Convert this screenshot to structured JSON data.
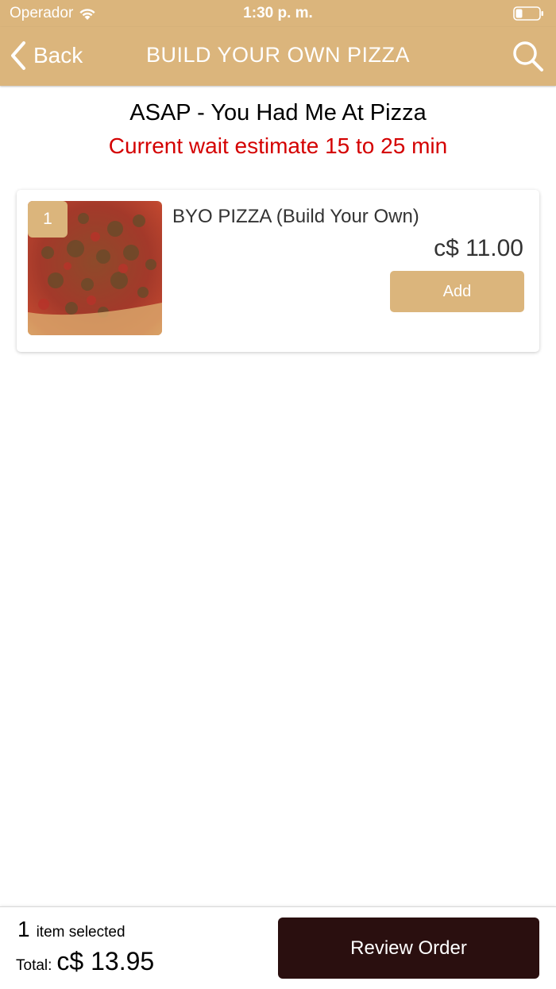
{
  "status_bar": {
    "carrier": "Operador",
    "time": "1:30 p. m."
  },
  "nav": {
    "back_label": "Back",
    "title": "BUILD YOUR OWN PIZZA"
  },
  "header": {
    "restaurant": "ASAP - You Had Me At Pizza",
    "wait_estimate": "Current wait estimate 15 to 25 min"
  },
  "items": [
    {
      "quantity": "1",
      "name": "BYO PIZZA (Build Your Own)",
      "price": "c$ 11.00",
      "add_label": "Add"
    }
  ],
  "footer": {
    "count": "1",
    "selected_text": "item selected",
    "total_label": "Total:",
    "total_value": "c$ 13.95",
    "review_label": "Review Order"
  },
  "colors": {
    "brand": "#dbb57c",
    "wait_text": "#d40000",
    "review_button": "#2a0f0f"
  }
}
